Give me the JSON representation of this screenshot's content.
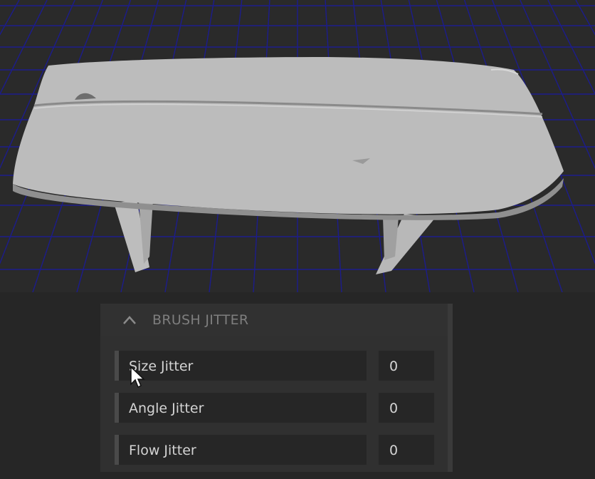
{
  "scene": {
    "object_icon": "table-3d-model",
    "grid_color": "#1c1c8c",
    "background_color": "#2a2a2a"
  },
  "panel": {
    "section_title": "BRUSH JITTER",
    "collapse_icon": "chevron-up-icon",
    "rows": [
      {
        "label": "Size Jitter",
        "value": "0"
      },
      {
        "label": "Angle Jitter",
        "value": "0"
      },
      {
        "label": "Flow Jitter",
        "value": "0"
      }
    ]
  },
  "cursor_icon": "mouse-pointer-icon"
}
